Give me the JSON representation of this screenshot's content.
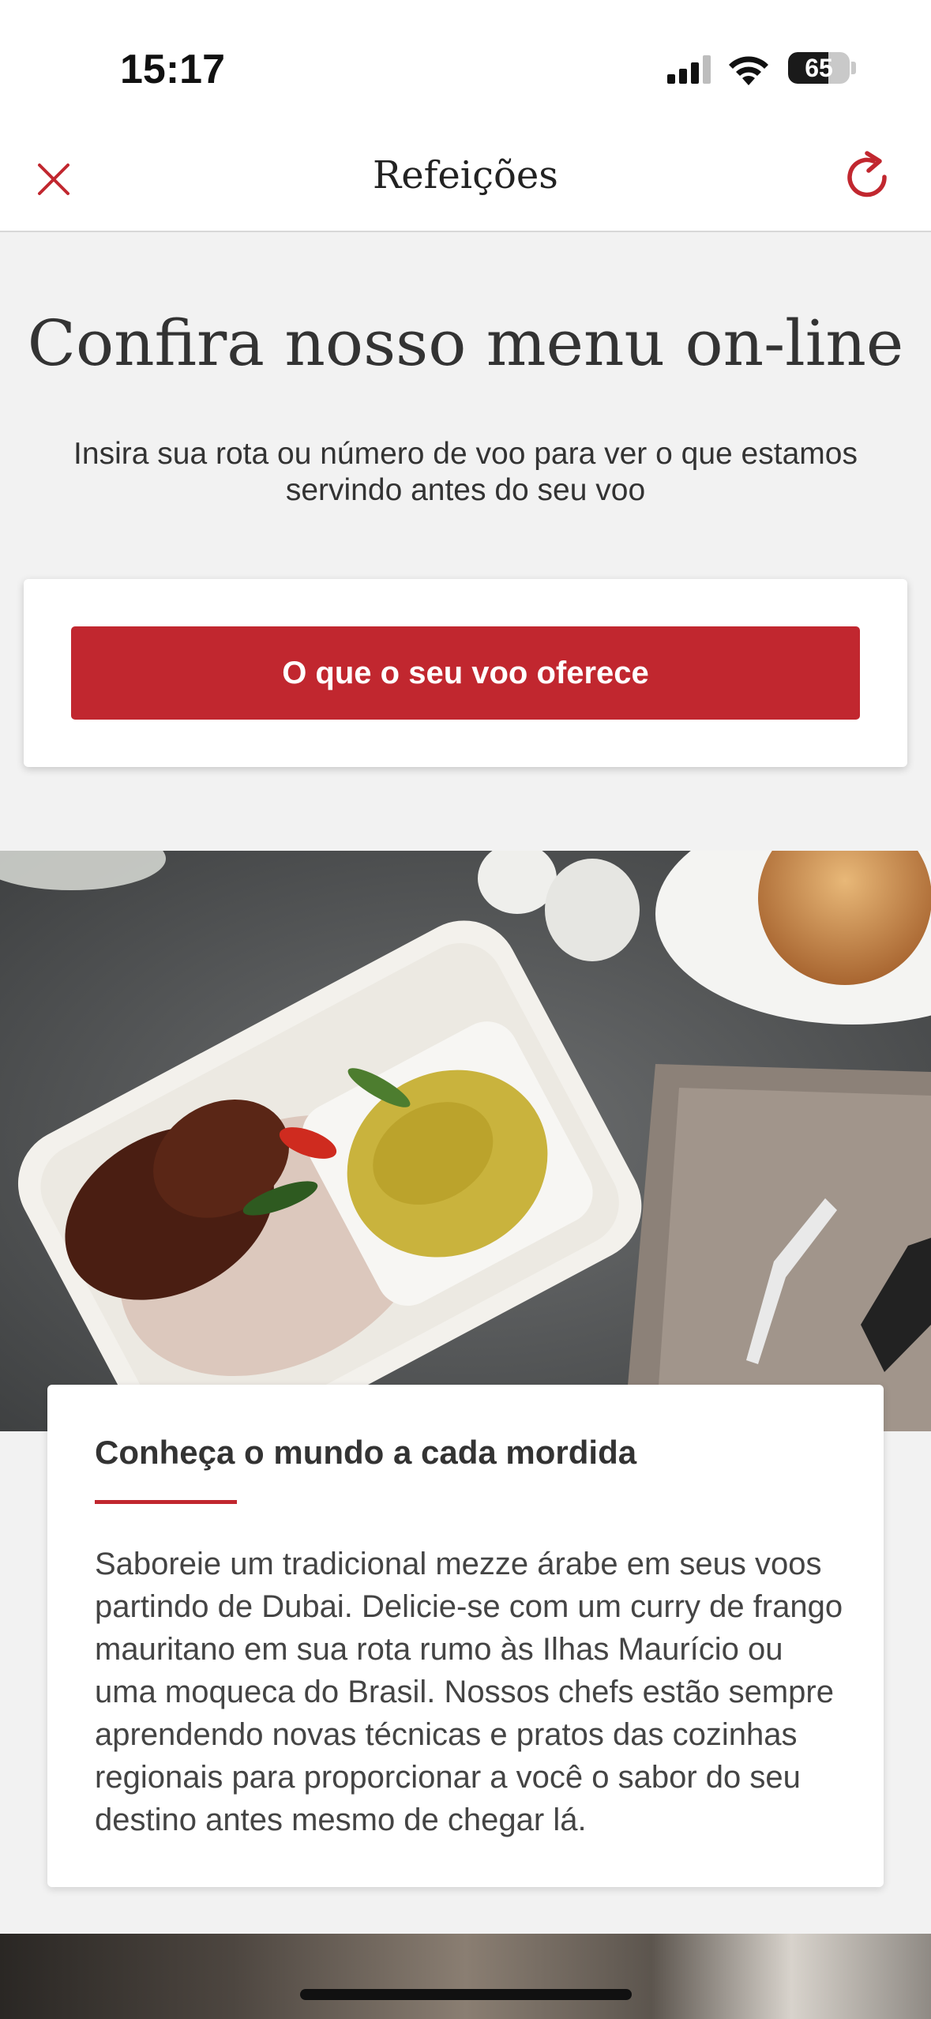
{
  "status_bar": {
    "time": "15:17",
    "battery": "65",
    "battery_level": 0.65
  },
  "header": {
    "title": "Refeições",
    "accent_color": "#c1272f"
  },
  "intro": {
    "title": "Confira nosso menu on-line",
    "description": "Insira sua rota ou número de voo para ver o que estamos servindo antes do seu voo"
  },
  "cta": {
    "label": "O que o seu voo oferece"
  },
  "feature": {
    "title": "Conheça o mundo a cada mordida",
    "body": "Saboreie um tradicional mezze árabe em seus voos partindo de Dubai. Delicie-se com um curry de frango mauritano em sua rota rumo às Ilhas Maurício ou uma moqueca do Brasil. Nossos chefs estão sempre aprendendo novas técnicas e pratos das cozinhas regionais para proporcionar a você o sabor do seu destino antes mesmo de chegar lá."
  },
  "icons": {
    "close": "close-icon",
    "refresh": "refresh-icon"
  }
}
